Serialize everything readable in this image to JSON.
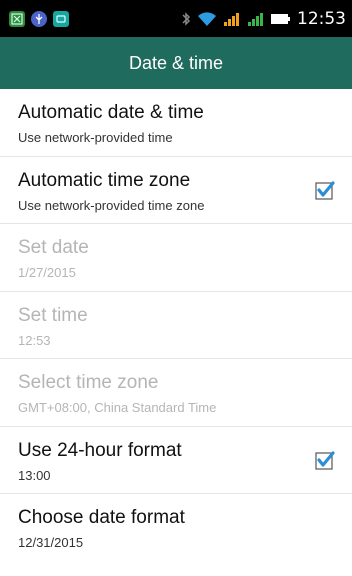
{
  "status_bar": {
    "time": "12:53",
    "icons": [
      "notification-app-icon",
      "usb-icon",
      "notification-app-icon",
      "bluetooth-icon",
      "wifi-icon",
      "signal-icon",
      "signal-icon",
      "battery-icon"
    ]
  },
  "app_bar": {
    "title": "Date & time"
  },
  "settings": [
    {
      "title": "Automatic date & time",
      "subtitle": "Use network-provided time",
      "enabled": true
    },
    {
      "title": "Automatic time zone",
      "subtitle": "Use network-provided time zone",
      "enabled": true,
      "checked": true
    },
    {
      "title": "Set date",
      "subtitle": "1/27/2015",
      "enabled": false
    },
    {
      "title": "Set time",
      "subtitle": "12:53",
      "enabled": false
    },
    {
      "title": "Select time zone",
      "subtitle": "GMT+08:00, China Standard Time",
      "enabled": false
    },
    {
      "title": "Use 24-hour format",
      "subtitle": "13:00",
      "enabled": true,
      "checked": true
    },
    {
      "title": "Choose date format",
      "subtitle": "12/31/2015",
      "enabled": true
    }
  ],
  "colors": {
    "app_bar": "#1f6b5e",
    "checkbox": "#2a8fd6",
    "disabled_text": "#b5b5b5"
  }
}
